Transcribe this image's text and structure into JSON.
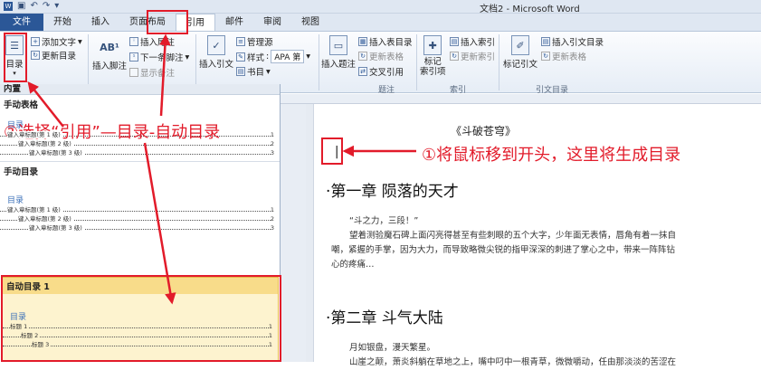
{
  "window": {
    "title": "文档2 - Microsoft Word"
  },
  "tabs": [
    "文件",
    "开始",
    "插入",
    "页面布局",
    "引用",
    "邮件",
    "审阅",
    "视图"
  ],
  "ribbon": {
    "toc_label": "目录",
    "add_text": "添加文字",
    "update_toc": "更新目录",
    "insert_footnote": "插入脚注",
    "insert_endnote": "插入尾注",
    "next_footnote": "下一条脚注",
    "show_notes": "显示备注",
    "insert_citation": "插入引文",
    "manage_sources": "管理源",
    "style_label": "样式",
    "style_value": "APA 第",
    "bibliography": "书目",
    "insert_caption": "插入题注",
    "insert_table_of_figures": "插入表目录",
    "update_table": "更新表格",
    "cross_reference": "交叉引用",
    "mark_entry": "标记\n索引项",
    "insert_index": "插入索引",
    "update_index": "更新索引",
    "mark_citation": "标记引文",
    "insert_toa": "插入引文目录",
    "update_toa": "更新表格",
    "group_caption": "题注",
    "group_index": "索引",
    "group_toa": "引文目录"
  },
  "gallery": {
    "builtin": "内置",
    "manual_table": "手动表格",
    "toc_heading": "目录",
    "manual_lines": [
      {
        "text": "键入章标题(第 1 级)",
        "page": "1"
      },
      {
        "text": "键入章标题(第 2 级)",
        "page": "2"
      },
      {
        "text": "键入章标题(第 3 级)",
        "page": "3"
      }
    ],
    "manual_toc": "手动目录",
    "manual_lines2": [
      {
        "text": "键入章标题(第 1 级)",
        "page": "1"
      },
      {
        "text": "键入章标题(第 2 级)",
        "page": "2"
      },
      {
        "text": "键入章标题(第 3 级)",
        "page": "3"
      }
    ],
    "auto_toc_1": "自动目录 1",
    "auto_lines": [
      {
        "text": "标题 1",
        "page": "1"
      },
      {
        "text": "标题 2",
        "page": "1"
      },
      {
        "text": "标题 3",
        "page": "1"
      }
    ]
  },
  "document": {
    "title": "《斗破苍穹》",
    "chapter1": "·第一章  陨落的天才",
    "ch1_quote": "“斗之力，三段！”",
    "ch1_p1": "望着测验魔石碑上面闪亮得甚至有些刺眼的五个大字，少年面无表情，唇角有着一抹自",
    "ch1_p2": "嘲，紧握的手掌，因为大力，而导致略微尖锐的指甲深深的刺进了掌心之中，带来一阵阵钻",
    "ch1_p3": "心的疼痛…",
    "chapter2": "·第二章  斗气大陆",
    "ch2_p1": "月如银盘，漫天繁星。",
    "ch2_p2": "山崖之颠，萧炎斜躺在草地之上，嘴中叼中一根青草，微微嚼动，任由那淡淡的苦涩在"
  },
  "annotations": {
    "step2": "②选择“引用”—目录-自动目录",
    "step1": "①将鼠标移到开头，这里将生成目录"
  },
  "colors": {
    "accent": "#2b5797",
    "annotation_red": "#e21b2a",
    "highlight": "#fdf3cf"
  }
}
